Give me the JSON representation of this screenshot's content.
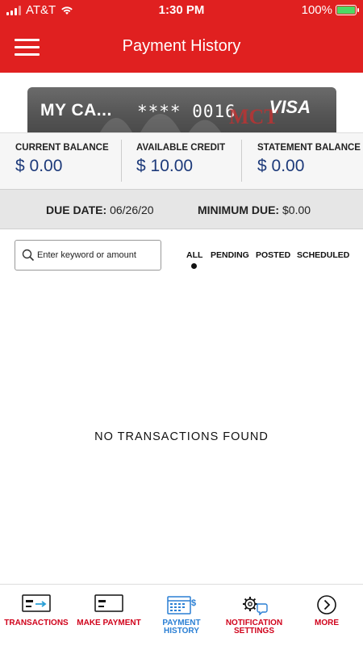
{
  "status_bar": {
    "carrier": "AT&T",
    "time": "1:30 PM",
    "battery": "100%",
    "icons": [
      "signal-icon",
      "wifi-icon",
      "battery-charging-icon"
    ]
  },
  "header": {
    "title": "Payment History",
    "menu_icon": "hamburger-menu-icon",
    "background_color": "#e02020"
  },
  "card": {
    "name": "MY CA...",
    "number": "**** 0016",
    "network": "VISA",
    "issuer_logo": "MCT"
  },
  "balances": [
    {
      "label": "CURRENT BALANCE",
      "value": "$ 0.00"
    },
    {
      "label": "AVAILABLE CREDIT",
      "value": "$ 10.00"
    },
    {
      "label": "STATEMENT BALANCE",
      "value": "$ 0.00"
    }
  ],
  "due": {
    "due_date_label": "DUE DATE:",
    "due_date_value": "06/26/20",
    "minimum_due_label": "MINIMUM DUE:",
    "minimum_due_value": "$0.00"
  },
  "search": {
    "placeholder": "Enter keyword or amount",
    "value": ""
  },
  "filters": {
    "options": [
      "ALL",
      "PENDING",
      "POSTED",
      "SCHEDULED"
    ],
    "selected": "ALL"
  },
  "empty_message": "NO TRANSACTIONS FOUND",
  "bottom_nav": {
    "items": [
      {
        "label_line1": "TRANSACTIONS",
        "label_line2": "",
        "icon": "card-transactions-icon"
      },
      {
        "label_line1": "MAKE PAYMENT",
        "label_line2": "",
        "icon": "card-payment-icon"
      },
      {
        "label_line1": "PAYMENT",
        "label_line2": "HISTORY",
        "icon": "calendar-dollar-icon"
      },
      {
        "label_line1": "NOTIFICATION",
        "label_line2": "SETTINGS",
        "icon": "gear-chat-icon"
      },
      {
        "label_line1": "MORE",
        "label_line2": "",
        "icon": "chevron-right-circle-icon"
      }
    ],
    "active": "PAYMENT HISTORY",
    "active_color": "#2a7fd4",
    "inactive_color": "#d0021b"
  }
}
